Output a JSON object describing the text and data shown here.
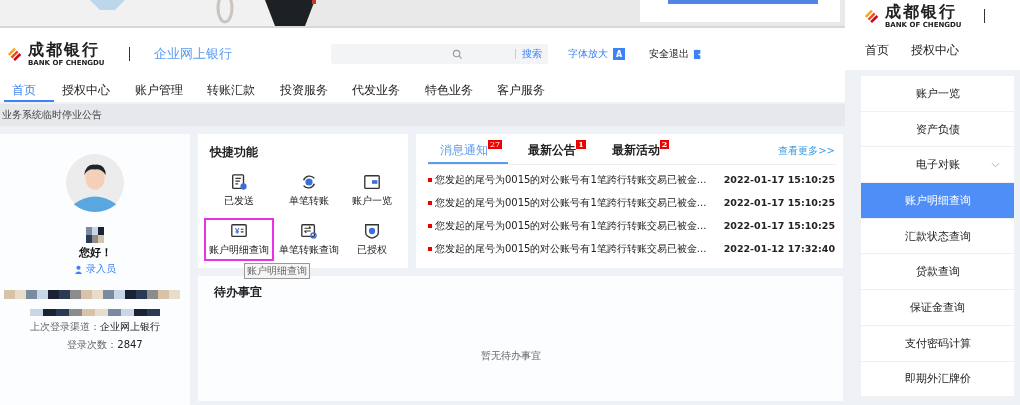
{
  "header": {
    "bank_name": "成都银行",
    "bank_name_en": "BANK OF CHENGDU",
    "product": "企业网上银行",
    "search_button": "搜索",
    "font_enlarge": "字体放大",
    "font_icon": "A",
    "logout": "安全退出"
  },
  "nav": [
    {
      "label": "首页",
      "selected": true
    },
    {
      "label": "授权中心",
      "selected": false
    },
    {
      "label": "账户管理",
      "selected": false
    },
    {
      "label": "转账汇款",
      "selected": false
    },
    {
      "label": "投资服务",
      "selected": false
    },
    {
      "label": "代发业务",
      "selected": false
    },
    {
      "label": "特色业务",
      "selected": false
    },
    {
      "label": "客户服务",
      "selected": false
    }
  ],
  "notice": "业务系统临时停业公告",
  "profile": {
    "greeting": "您好！",
    "role": "录入员",
    "last_channel_label": "上次登录渠道：",
    "last_channel": "企业网上银行",
    "login_count_label": "登录次数：",
    "login_count": "2847"
  },
  "quick": {
    "title": "快捷功能",
    "tooltip": "账户明细查询",
    "items": [
      {
        "label": "已发送",
        "highlighted": false
      },
      {
        "label": "单笔转账",
        "highlighted": false
      },
      {
        "label": "账户一览",
        "highlighted": false
      },
      {
        "label": "账户明细查询",
        "highlighted": true
      },
      {
        "label": "单笔转账查询",
        "highlighted": false
      },
      {
        "label": "已授权",
        "highlighted": false
      }
    ]
  },
  "news": {
    "more": "查看更多>>",
    "tabs": [
      {
        "label": "消息通知",
        "badge": "27",
        "selected": true
      },
      {
        "label": "最新公告",
        "badge": "1",
        "selected": false
      },
      {
        "label": "最新活动",
        "badge": "2",
        "selected": false
      }
    ],
    "items": [
      {
        "text": "您发起的尾号为0015的对公账号有1笔跨行转账交易已被金...",
        "time": "2022-01-17 15:10:25"
      },
      {
        "text": "您发起的尾号为0015的对公账号有1笔跨行转账交易已被金...",
        "time": "2022-01-17 15:10:25"
      },
      {
        "text": "您发起的尾号为0015的对公账号有1笔跨行转账交易已被金...",
        "time": "2022-01-17 15:10:25"
      },
      {
        "text": "您发起的尾号为0015的对公账号有1笔跨行转账交易已被金...",
        "time": "2022-01-12 17:32:40"
      }
    ]
  },
  "todo": {
    "title": "待办事宜",
    "empty": "暂无待办事宜"
  },
  "side_panel": {
    "bank_name": "成都银行",
    "bank_name_en": "BANK OF CHENGDU",
    "nav": [
      {
        "label": "首页",
        "selected": false
      },
      {
        "label": "授权中心",
        "selected": false
      }
    ],
    "menu": [
      {
        "label": "账户一览",
        "selected": false,
        "expandable": false
      },
      {
        "label": "资产负债",
        "selected": false,
        "expandable": false
      },
      {
        "label": "电子对账",
        "selected": false,
        "expandable": true
      },
      {
        "label": "账户明细查询",
        "selected": true,
        "expandable": false
      },
      {
        "label": "汇款状态查询",
        "selected": false,
        "expandable": false
      },
      {
        "label": "贷款查询",
        "selected": false,
        "expandable": false
      },
      {
        "label": "保证金查询",
        "selected": false,
        "expandable": false
      },
      {
        "label": "支付密码计算",
        "selected": false,
        "expandable": false
      },
      {
        "label": "即期外汇牌价",
        "selected": false,
        "expandable": false
      }
    ]
  }
}
